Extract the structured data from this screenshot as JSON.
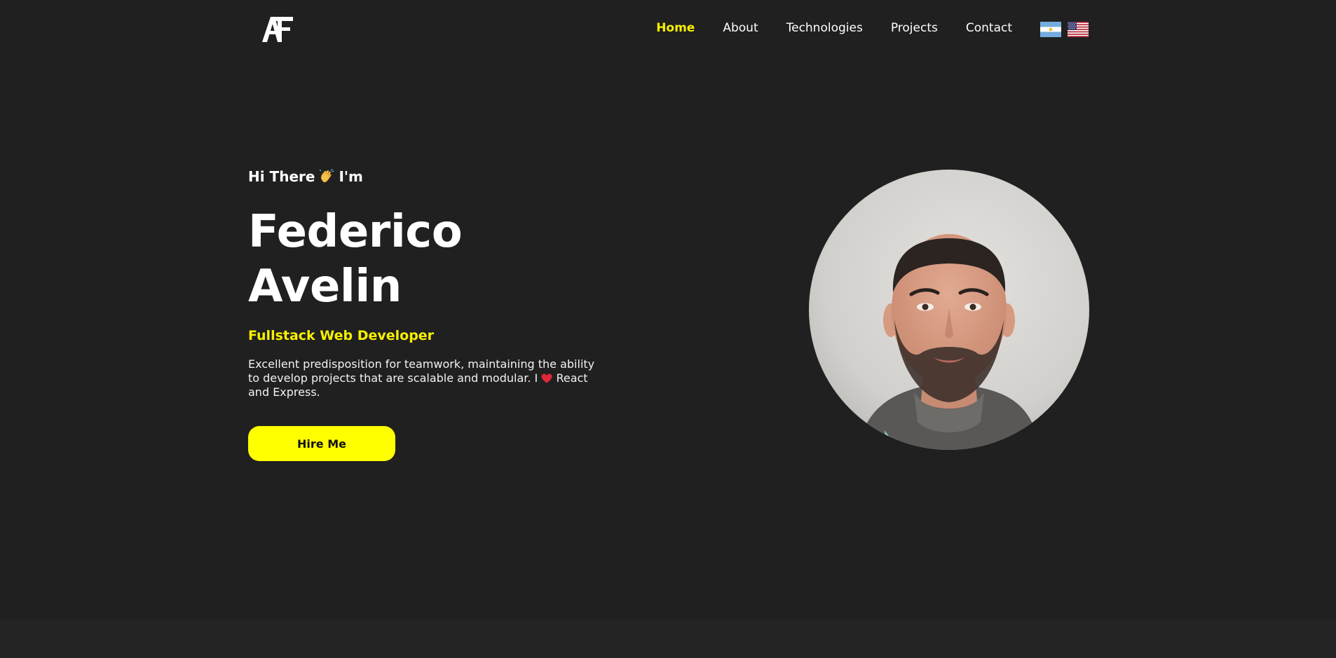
{
  "nav": {
    "logo_text": "AF",
    "links": [
      {
        "label": "Home",
        "active": true
      },
      {
        "label": "About",
        "active": false
      },
      {
        "label": "Technologies",
        "active": false
      },
      {
        "label": "Projects",
        "active": false
      },
      {
        "label": "Contact",
        "active": false
      }
    ],
    "flags": [
      "argentina-flag-icon",
      "usa-flag-icon"
    ]
  },
  "hero": {
    "greeting_before": "Hi There",
    "greeting_after": "I'm",
    "greeting_icon": "waving-hand-icon",
    "first_name": "Federico",
    "last_name": "Avelin",
    "role": "Fullstack Web Developer",
    "description_before": "Excellent predisposition for teamwork, maintaining the ability to develop projects that are scalable and modular. I",
    "description_icon": "heart-icon",
    "description_after": "React and Express.",
    "cta_label": "Hire Me"
  },
  "colors": {
    "background": "#202020",
    "accent": "#f7f000",
    "button": "#ffff00",
    "text": "#ffffff"
  }
}
